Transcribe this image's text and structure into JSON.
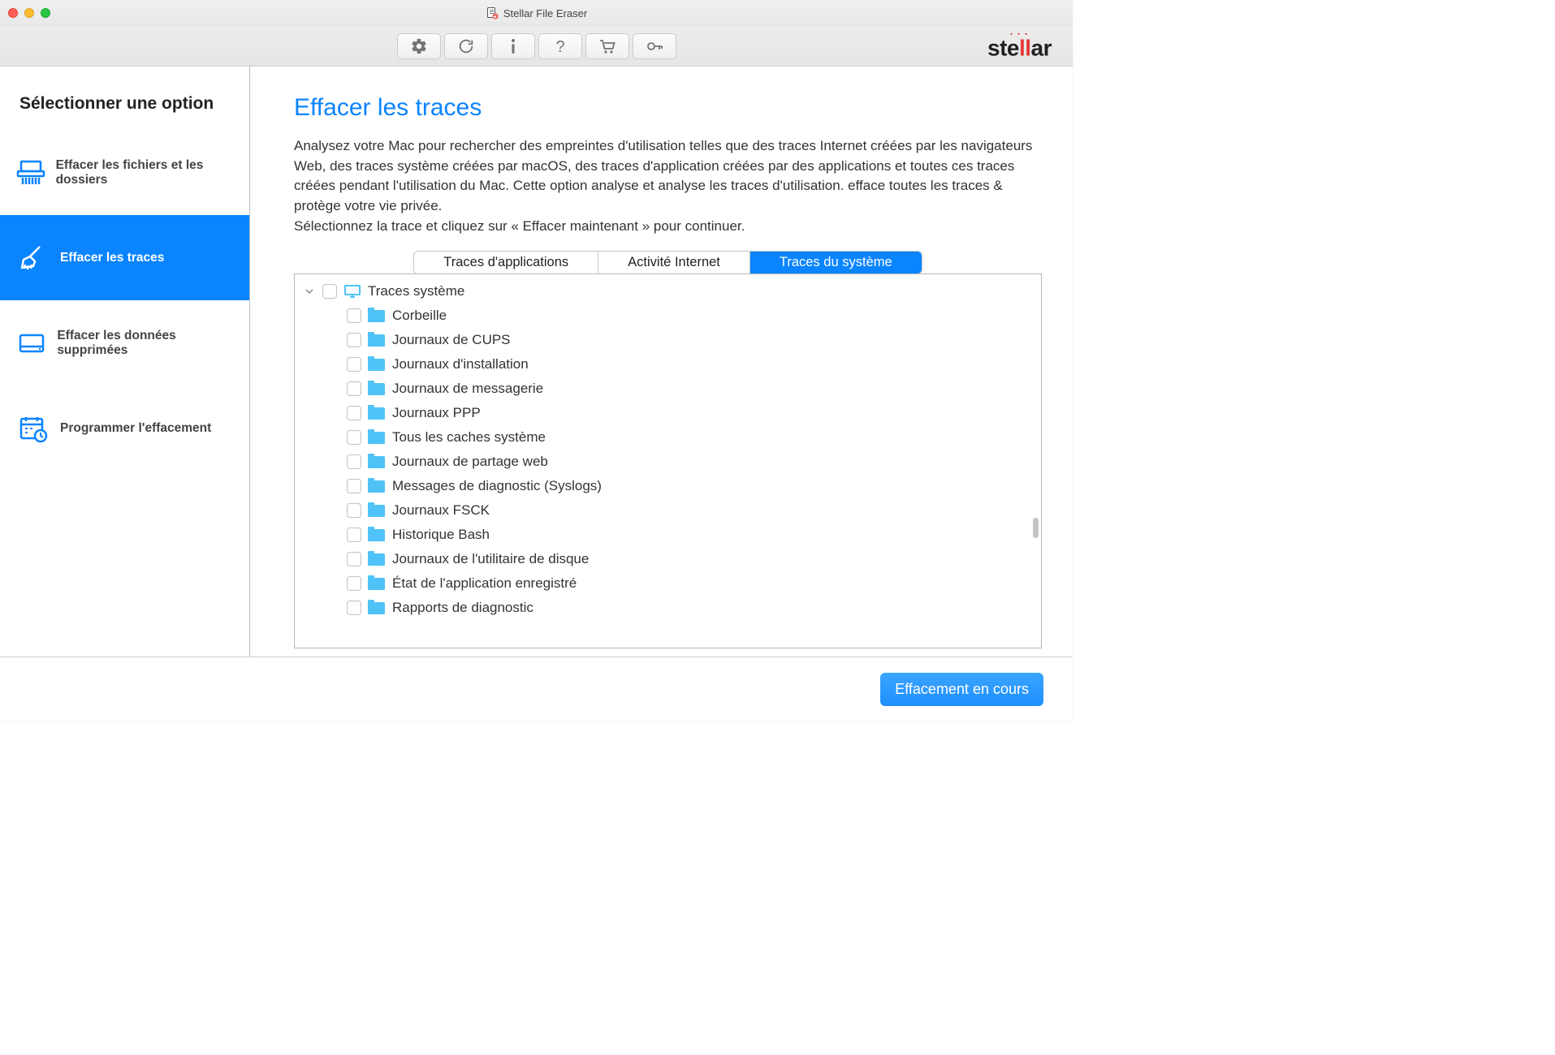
{
  "window": {
    "title": "Stellar File Eraser"
  },
  "brand": {
    "name": "stellar"
  },
  "toolbar": {
    "settings": "settings",
    "refresh": "refresh",
    "info": "info",
    "help": "help",
    "cart": "cart",
    "key": "key"
  },
  "sidebar": {
    "title": "Sélectionner une option",
    "items": [
      {
        "label": "Effacer les fichiers et les dossiers",
        "active": false
      },
      {
        "label": "Effacer les traces",
        "active": true
      },
      {
        "label": "Effacer les données supprimées",
        "active": false
      },
      {
        "label": "Programmer l'effacement",
        "active": false
      }
    ]
  },
  "page": {
    "title": "Effacer les traces",
    "desc1": "Analysez votre Mac pour rechercher des empreintes d'utilisation telles que des traces Internet créées par les navigateurs Web, des traces système créées par macOS, des traces d'application créées par des applications et toutes ces traces créées pendant l'utilisation du Mac. Cette option analyse et analyse les traces d'utilisation. efface toutes les traces & protège votre vie privée.",
    "desc2": "Sélectionnez la trace et cliquez sur « Effacer maintenant » pour continuer."
  },
  "tabs": [
    {
      "label": "Traces d'applications",
      "active": false
    },
    {
      "label": "Activité Internet",
      "active": false
    },
    {
      "label": "Traces du système",
      "active": true
    }
  ],
  "tree": {
    "root": "Traces système",
    "children": [
      "Corbeille",
      "Journaux de CUPS",
      "Journaux d'installation",
      "Journaux de messagerie",
      "Journaux PPP",
      "Tous les caches système",
      "Journaux de partage web",
      "Messages de diagnostic (Syslogs)",
      "Journaux FSCK",
      "Historique Bash",
      "Journaux de l'utilitaire de disque",
      "État de l'application enregistré",
      "Rapports de diagnostic"
    ]
  },
  "footer": {
    "action": "Effacement en cours"
  }
}
